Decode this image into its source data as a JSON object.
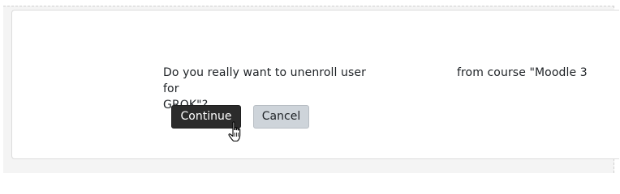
{
  "dialog": {
    "message_part1": "Do you really want to unenroll user",
    "message_part2": "from course \"Moodle 3 for",
    "message_line2": "GROK\"?"
  },
  "buttons": {
    "continue_label": "Continue",
    "cancel_label": "Cancel"
  },
  "colors": {
    "primary_button_bg": "#2b2b2b",
    "secondary_button_bg": "#ced4da",
    "text": "#1d2125"
  },
  "icons": {
    "cursor": "hand-pointer-icon"
  }
}
